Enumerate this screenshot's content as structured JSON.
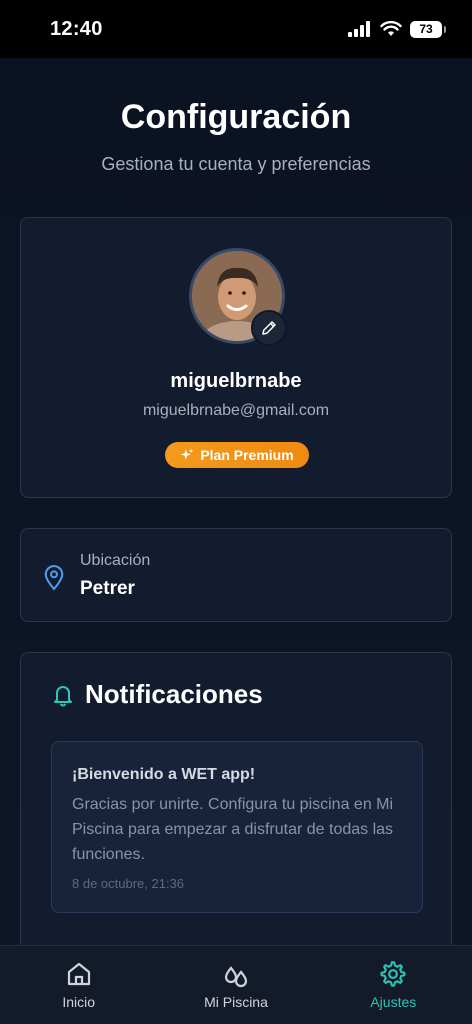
{
  "status_bar": {
    "time": "12:40",
    "battery": "73"
  },
  "header": {
    "title": "Configuración",
    "subtitle": "Gestiona tu cuenta y preferencias"
  },
  "profile": {
    "name": "miguelbrnabe",
    "email": "miguelbrnabe@gmail.com",
    "plan_badge": "Plan Premium"
  },
  "location": {
    "label": "Ubicación",
    "value": "Petrer"
  },
  "notifications": {
    "title": "Notificaciones",
    "items": [
      {
        "title": "¡Bienvenido a WET app!",
        "body": "Gracias por unirte. Configura tu piscina en Mi Piscina para empezar a disfrutar de todas las funciones.",
        "time": "8 de octubre, 21:36"
      }
    ]
  },
  "bottom_nav": {
    "items": [
      {
        "label": "Inicio",
        "icon": "home-icon"
      },
      {
        "label": "Mi Piscina",
        "icon": "water-drops-icon"
      },
      {
        "label": "Ajustes",
        "icon": "gear-icon"
      }
    ],
    "active": "Ajustes"
  },
  "colors": {
    "accent": "#2ec4b6",
    "premium": "#f49a1c",
    "background": "#0c1322"
  }
}
